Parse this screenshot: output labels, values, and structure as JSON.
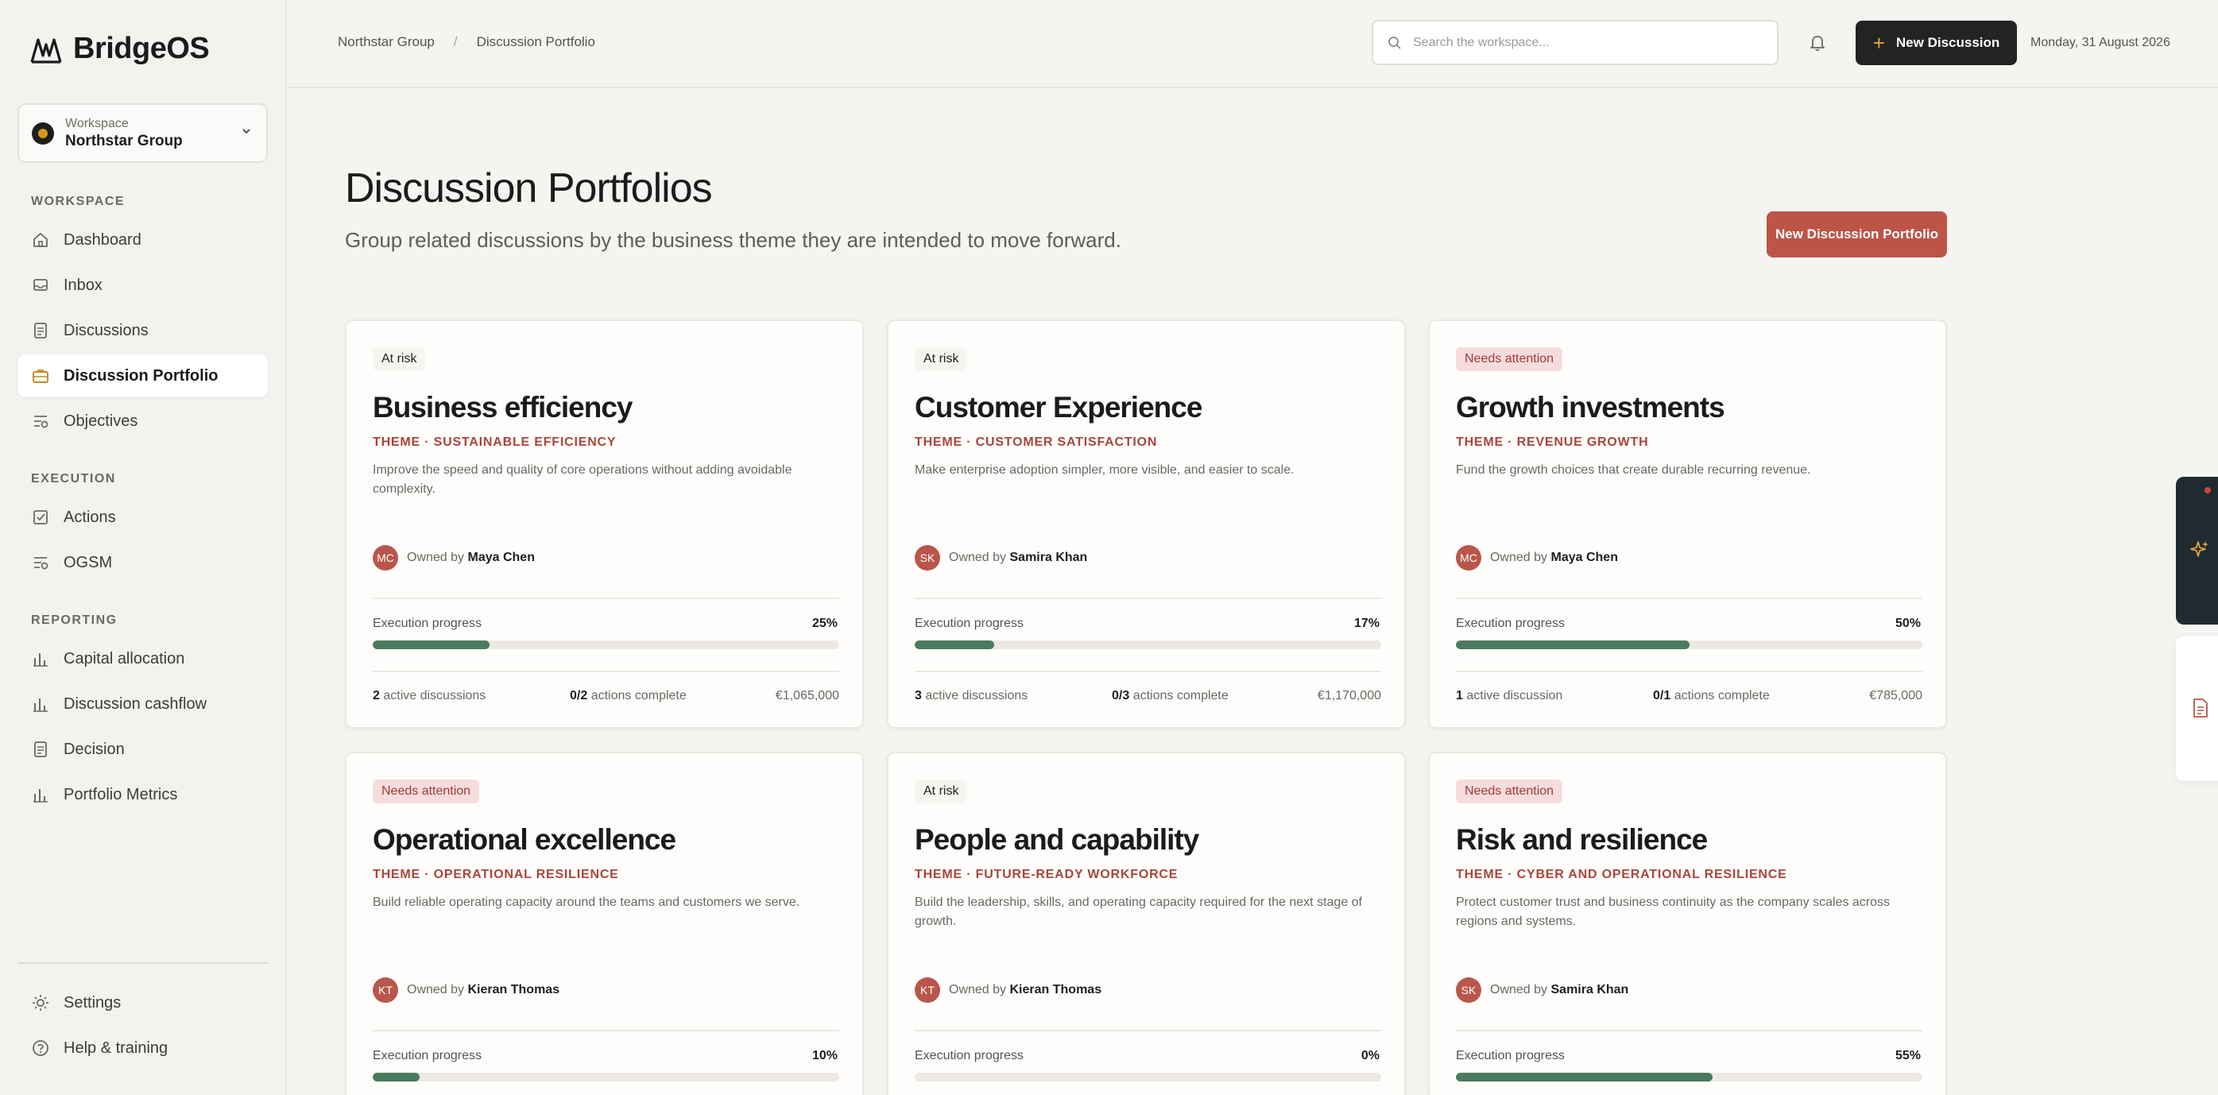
{
  "app": {
    "name": "BridgeOS"
  },
  "workspace": {
    "kicker": "Workspace",
    "name": "Northstar Group"
  },
  "nav": {
    "workspace_section": "WORKSPACE",
    "workspace_items": [
      {
        "label": "Dashboard",
        "icon": "home-icon"
      },
      {
        "label": "Inbox",
        "icon": "inbox-icon"
      },
      {
        "label": "Discussions",
        "icon": "document-icon"
      },
      {
        "label": "Discussion Portfolio",
        "icon": "briefcase-icon",
        "active": true
      },
      {
        "label": "Objectives",
        "icon": "objectives-icon"
      }
    ],
    "execution_section": "EXECUTION",
    "execution_items": [
      {
        "label": "Actions",
        "icon": "checkbox-icon"
      },
      {
        "label": "OGSM",
        "icon": "objectives-icon"
      }
    ],
    "reporting_section": "REPORTING",
    "reporting_items": [
      {
        "label": "Capital allocation",
        "icon": "bar-chart-icon"
      },
      {
        "label": "Discussion cashflow",
        "icon": "bar-chart-icon"
      },
      {
        "label": "Decision",
        "icon": "document-icon"
      },
      {
        "label": "Portfolio Metrics",
        "icon": "bar-chart-icon"
      }
    ],
    "bottom_items": [
      {
        "label": "Settings",
        "icon": "sun-gear-icon"
      },
      {
        "label": "Help & training",
        "icon": "help-circle-icon"
      }
    ]
  },
  "topbar": {
    "breadcrumbs": [
      "Northstar Group",
      "Discussion Portfolio"
    ],
    "breadcrumb_sep": "/",
    "search_placeholder": "Search the workspace...",
    "new_discussion_label": "New Discussion",
    "date": "Monday, 31 August 2026"
  },
  "header": {
    "title": "Discussion Portfolios",
    "subtitle": "Group related discussions by the business theme they are intended to move forward.",
    "new_portfolio_label": "New Discussion Portfolio"
  },
  "labels": {
    "owned_by": "Owned by",
    "execution_progress": "Execution progress",
    "actions_complete": "actions complete"
  },
  "portfolios": [
    {
      "status": "At risk",
      "status_kind": "risk",
      "title": "Business efficiency",
      "theme": "THEME · SUSTAINABLE EFFICIENCY",
      "description": "Improve the speed and quality of core operations without adding avoidable complexity.",
      "owner_initials": "MC",
      "owner": "Maya Chen",
      "progress": 25,
      "progress_text": "25%",
      "discussions_count": "2",
      "discussions_label": "active discussions",
      "actions_ratio": "0/2",
      "value": "€1,065,000"
    },
    {
      "status": "At risk",
      "status_kind": "risk",
      "title": "Customer Experience",
      "theme": "THEME · CUSTOMER SATISFACTION",
      "description": "Make enterprise adoption simpler, more visible, and easier to scale.",
      "owner_initials": "SK",
      "owner": "Samira Khan",
      "progress": 17,
      "progress_text": "17%",
      "discussions_count": "3",
      "discussions_label": "active discussions",
      "actions_ratio": "0/3",
      "value": "€1,170,000"
    },
    {
      "status": "Needs attention",
      "status_kind": "attn",
      "title": "Growth investments",
      "theme": "THEME · REVENUE GROWTH",
      "description": "Fund the growth choices that create durable recurring revenue.",
      "owner_initials": "MC",
      "owner": "Maya Chen",
      "progress": 50,
      "progress_text": "50%",
      "discussions_count": "1",
      "discussions_label": "active discussion",
      "actions_ratio": "0/1",
      "value": "€785,000"
    },
    {
      "status": "Needs attention",
      "status_kind": "attn",
      "title": "Operational excellence",
      "theme": "THEME · OPERATIONAL RESILIENCE",
      "description": "Build reliable operating capacity around the teams and customers we serve.",
      "owner_initials": "KT",
      "owner": "Kieran Thomas",
      "progress": 10,
      "progress_text": "10%"
    },
    {
      "status": "At risk",
      "status_kind": "risk",
      "title": "People and capability",
      "theme": "THEME · FUTURE-READY WORKFORCE",
      "description": "Build the leadership, skills, and operating capacity required for the next stage of growth.",
      "owner_initials": "KT",
      "owner": "Kieran Thomas",
      "progress": 0,
      "progress_text": "0%"
    },
    {
      "status": "Needs attention",
      "status_kind": "attn",
      "title": "Risk and resilience",
      "theme": "THEME · CYBER AND OPERATIONAL RESILIENCE",
      "description": "Protect customer trust and business continuity as the company scales across regions and systems.",
      "owner_initials": "SK",
      "owner": "Samira Khan",
      "progress": 55,
      "progress_text": "55%"
    }
  ],
  "colors": {
    "accent_red": "#bd5448",
    "progress_green": "#4b7b5f",
    "dark_button": "#232323",
    "attention_badge_bg": "#f6dcdc"
  }
}
